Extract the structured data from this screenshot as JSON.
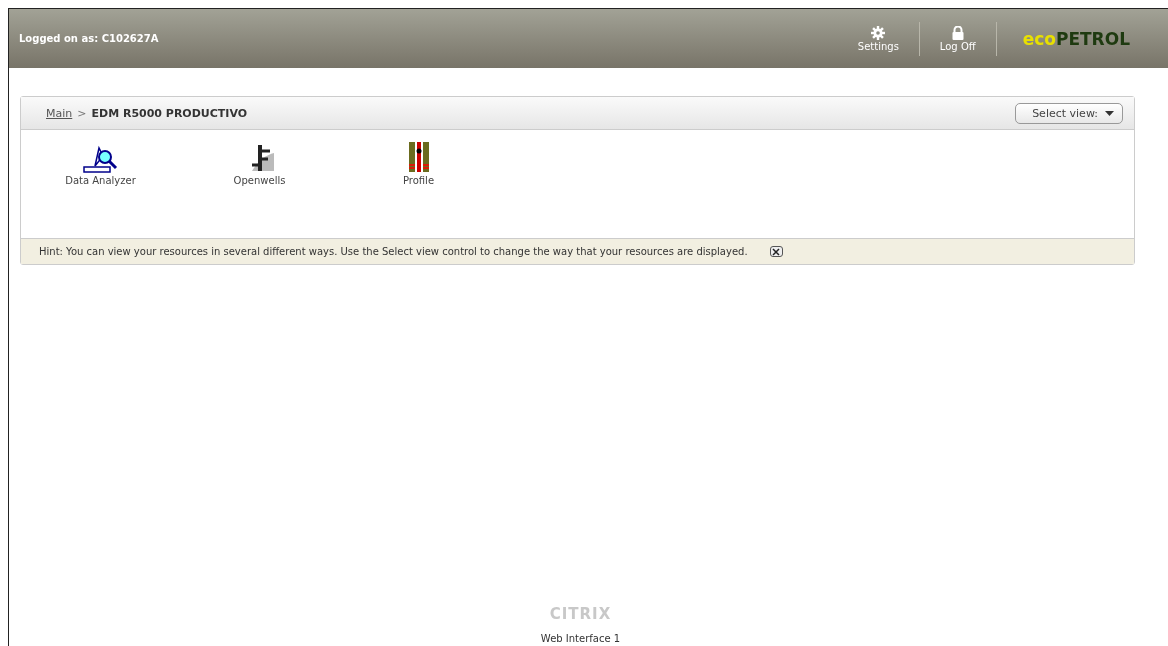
{
  "header": {
    "logged_on": "Logged on as: C102627A",
    "actions": [
      {
        "kind": "settings",
        "label": "Settings"
      },
      {
        "kind": "logoff",
        "label": "Log Off"
      }
    ],
    "logo": {
      "part_1": "eco",
      "part_2": "PETROL"
    }
  },
  "breadcrumb": {
    "link": "Main",
    "separator": ">",
    "current": "EDM R5000 PRODUCTIVO"
  },
  "select_view": {
    "label": "Select view:"
  },
  "resources": [
    {
      "kind": "analyzer",
      "label": "Data Analyzer"
    },
    {
      "kind": "openwells",
      "label": "Openwells"
    },
    {
      "kind": "profile",
      "label": "Profile"
    }
  ],
  "hint": {
    "text": "Hint: You can view your resources in several different ways. Use the Select view control to change the way that your resources are displayed."
  },
  "footer": {
    "logo": "CITRIX",
    "caption": "Web Interface 1"
  }
}
